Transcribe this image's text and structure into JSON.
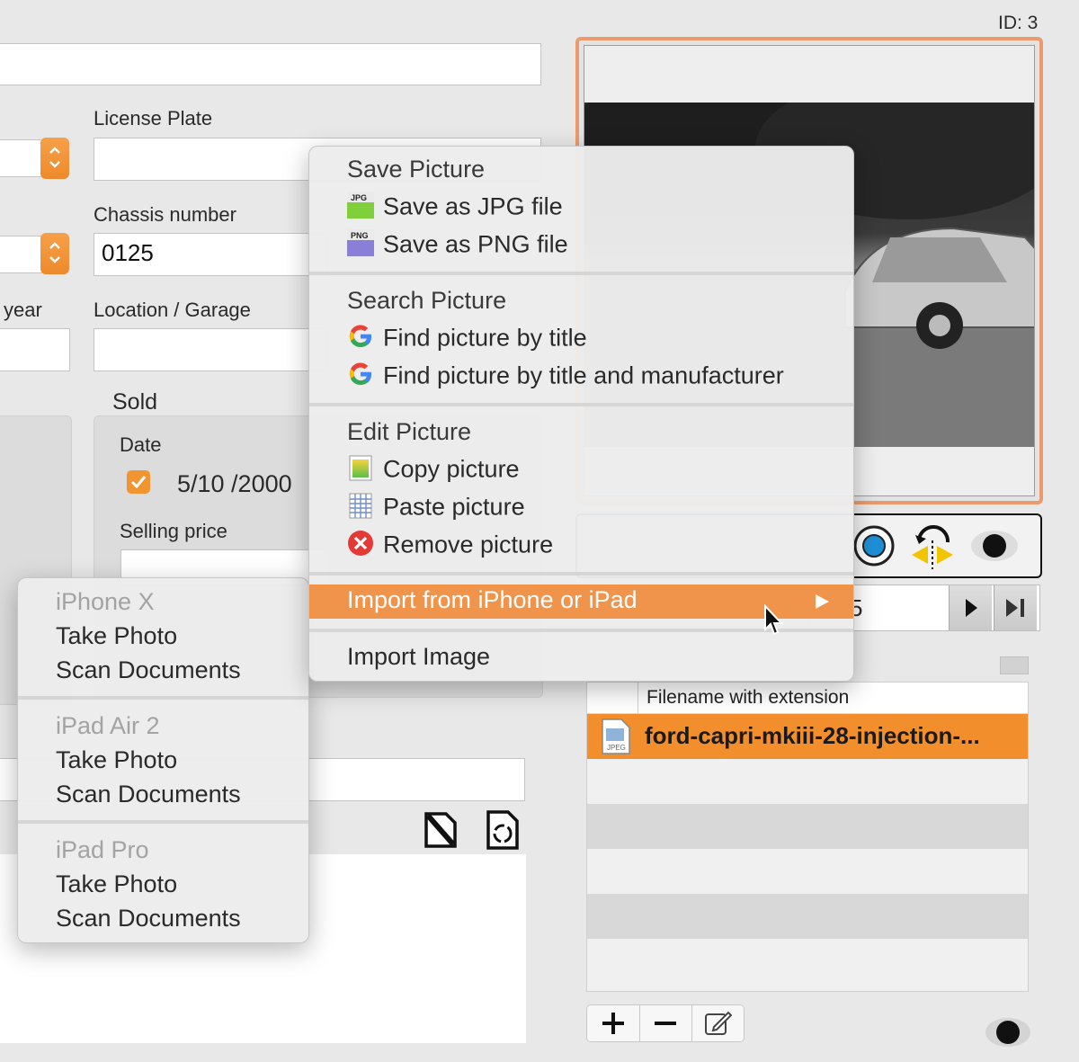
{
  "record": {
    "id_label": "ID: 3"
  },
  "form": {
    "license_plate_label": "License Plate",
    "license_plate_value": "",
    "chassis_label": "Chassis number",
    "chassis_value": "0125",
    "year_label": "year",
    "location_label": "Location / Garage",
    "sold_label": "Sold",
    "date_label": "Date",
    "date_value": "5/10 /2000",
    "selling_price_label": "Selling price"
  },
  "file_table": {
    "column_header": "Filename with extension",
    "rows": [
      {
        "name": "ford-capri-mkiii-28-injection-..."
      }
    ]
  },
  "navigator": {
    "page_fragment": "5"
  },
  "context_menu": {
    "save_section": "Save Picture",
    "save_jpg": "Save as JPG file",
    "save_png": "Save as PNG file",
    "search_section": "Search Picture",
    "find_title": "Find picture by title",
    "find_title_manufacturer": "Find picture by title and manufacturer",
    "edit_section": "Edit Picture",
    "copy": "Copy picture",
    "paste": "Paste picture",
    "remove": "Remove picture",
    "import_device": "Import from iPhone or iPad",
    "import_image": "Import Image",
    "jpg_badge": "JPG",
    "png_badge": "PNG",
    "highlight_color": "#f0934b"
  },
  "device_submenu": {
    "devices": [
      {
        "name": "iPhone X",
        "take_photo": "Take Photo",
        "scan": "Scan Documents"
      },
      {
        "name": "iPad Air 2",
        "take_photo": "Take Photo",
        "scan": "Scan Documents"
      },
      {
        "name": "iPad Pro",
        "take_photo": "Take Photo",
        "scan": "Scan Documents"
      }
    ]
  },
  "colors": {
    "accent": "#f29430",
    "frame": "#ec9a6c",
    "selection": "#f28e2c"
  }
}
